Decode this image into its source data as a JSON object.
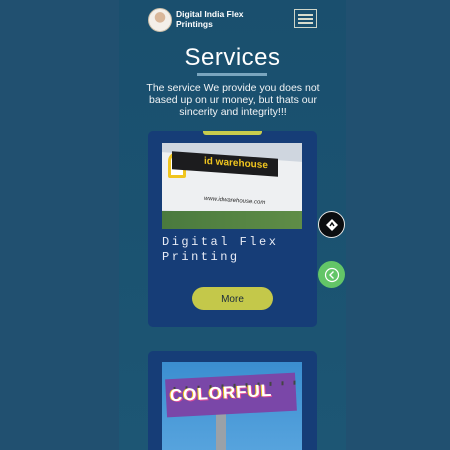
{
  "app": {
    "brand_name": "Digital India Flex Printings"
  },
  "header": {
    "menu_icon": "hamburger-icon",
    "avatar_icon": "user-avatar"
  },
  "main": {
    "title": "Services",
    "intro": "The service We provide you does not based up on ur money, but thats our sincerity and integrity!!!"
  },
  "services": [
    {
      "title": "Digital Flex Printing",
      "button_label": "More",
      "image_text": {
        "banner": "id warehouse",
        "website": "www.idwarehouse.com"
      }
    },
    {
      "image_text": {
        "billboard": "COLORFUL"
      }
    }
  ],
  "floating_buttons": {
    "nav_icon": "navigation-diamond-icon",
    "back_icon": "back-arrow-icon"
  },
  "colors": {
    "accent": "#c4c84a",
    "card": "#163d77",
    "background": "#1a4f6e",
    "fab_green": "#63c567"
  }
}
